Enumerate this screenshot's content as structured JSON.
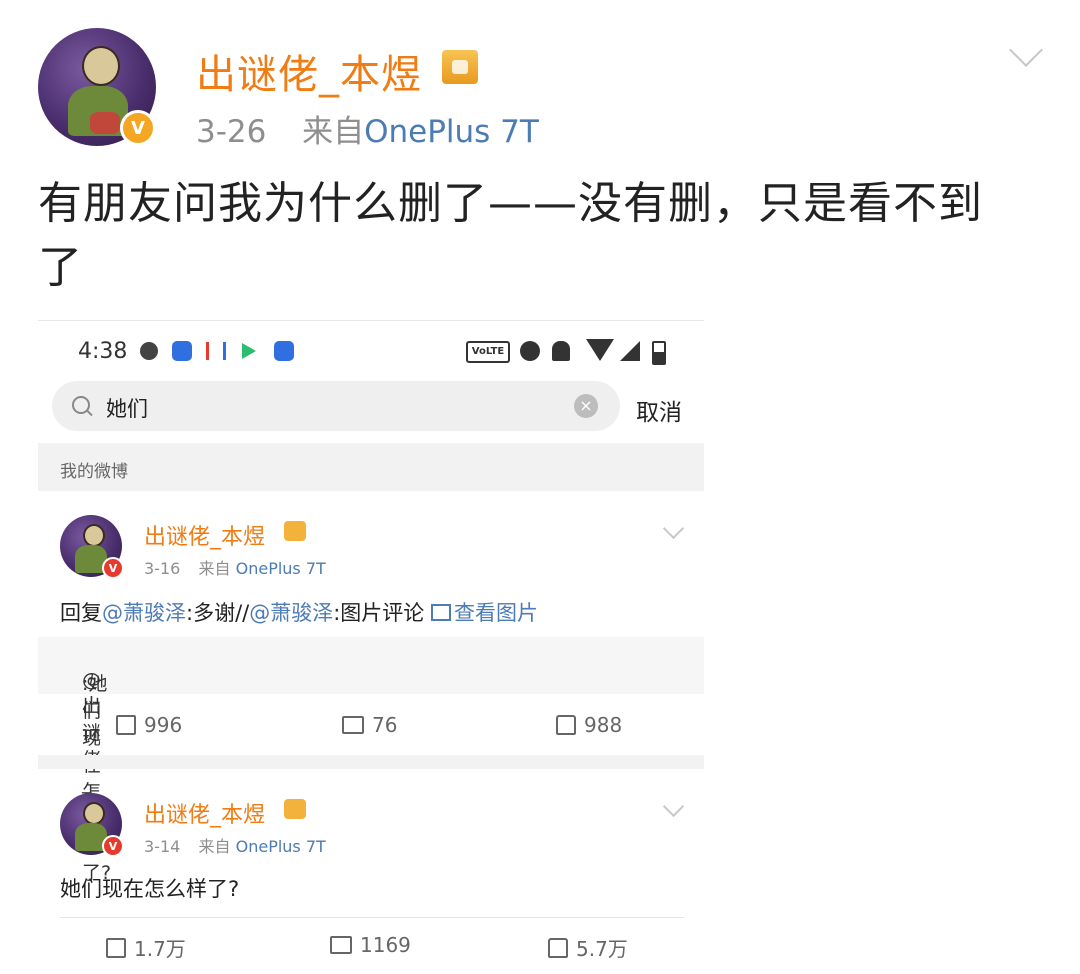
{
  "post": {
    "author": "出谜佬_本煜",
    "date": "3-26",
    "source_prefix": "来自",
    "source_device": "OnePlus 7T",
    "text_line1": "有朋友问我为什么删了——没有删，只是看不到",
    "text_line2": "了"
  },
  "screenshot": {
    "status": {
      "time": "4:38",
      "volte_label": "VoLTE"
    },
    "search": {
      "query": "她们",
      "cancel_label": "取消"
    },
    "section_title": "我的微博",
    "cards": [
      {
        "author": "出谜佬_本煜",
        "date": "3-16",
        "source_prefix": "来自",
        "source_device": "OnePlus 7T",
        "text_prefix": "回复",
        "mention1": "@萧骏泽",
        "text_mid": ":多谢//",
        "mention2": "@萧骏泽",
        "text_after": ":图片评论 ",
        "view_image": "查看图片",
        "quote_mention": "@出谜佬_本煜",
        "quote_text": " :她们现在怎么样了?",
        "reposts": "996",
        "comments": "76",
        "likes": "988"
      },
      {
        "author": "出谜佬_本煜",
        "date": "3-14",
        "source_prefix": "来自",
        "source_device": "OnePlus 7T",
        "text": "她们现在怎么样了?",
        "reposts": "1.7万",
        "comments": "1169",
        "likes": "5.7万"
      }
    ]
  },
  "colors": {
    "name_orange": "#f07c13",
    "link_blue": "#4d7bb3",
    "meta_gray": "#8e8e8e",
    "verified_gold": "#f5a623",
    "verified_red": "#e53a2d"
  }
}
